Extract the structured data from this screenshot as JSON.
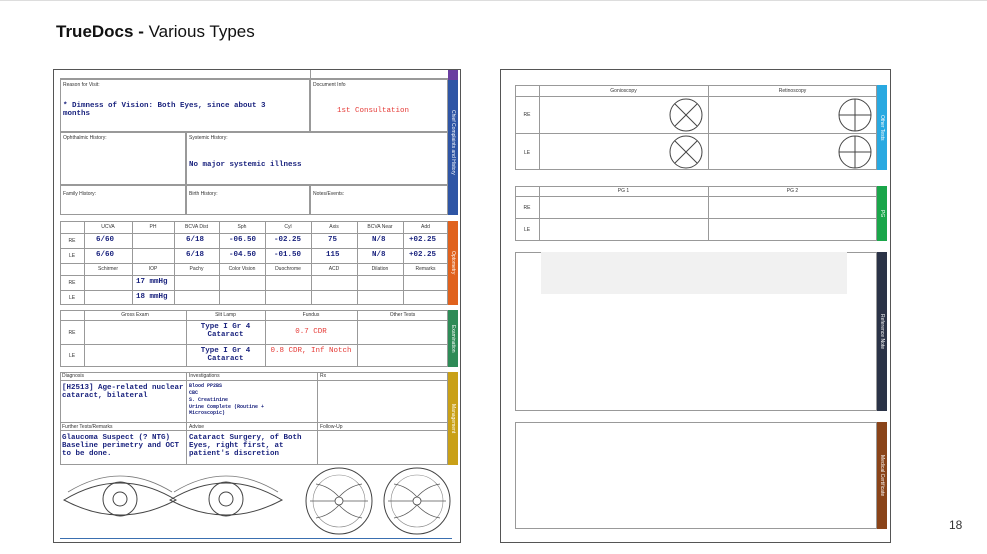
{
  "slide": {
    "title_bold": "TrueDocs -",
    "title_rest": " Various Types",
    "page_number": "18"
  },
  "left_doc": {
    "reason_label": "Reason for Visit:",
    "document_info_label": "Document Info",
    "reason_text": "* Dimness of Vision: Both Eyes, since about 3 months",
    "document_info_value": "1st Consultation",
    "ophthalmic_history_label": "Ophthalmic History:",
    "systemic_history_label": "Systemic History:",
    "systemic_history_value": "No major systemic illness",
    "family_history_label": "Family History:",
    "birth_history_label": "Birth History:",
    "notes_label": "Notes/Events:",
    "tab_chief": "Chief Complaints and History",
    "tab_optometry": "Optometry",
    "tab_examination": "Examination",
    "tab_management": "Management",
    "opto_headers": [
      "UCVA",
      "PH",
      "BCVA Dist",
      "Sph",
      "Cyl",
      "Axis",
      "BCVA Near",
      "Add"
    ],
    "opto_rows": [
      {
        "eye": "RE",
        "values": [
          "6/60",
          "",
          "6/18",
          "-06.50",
          "-02.25",
          "75",
          "N/8",
          "+02.25"
        ]
      },
      {
        "eye": "LE",
        "values": [
          "6/60",
          "",
          "6/18",
          "-04.50",
          "-01.50",
          "115",
          "N/8",
          "+02.25"
        ]
      }
    ],
    "opto2_headers": [
      "Schirmer",
      "IOP",
      "Pachy",
      "Color Vision",
      "Duochrome",
      "ACD",
      "Dilation",
      "Remarks"
    ],
    "opto2_rows": [
      {
        "eye": "RE",
        "iop": "17 mmHg"
      },
      {
        "eye": "LE",
        "iop": "18 mmHg"
      }
    ],
    "exam_headers": [
      "Gross Exam",
      "Slit Lamp",
      "Fundus",
      "Other Tests"
    ],
    "exam_rows": [
      {
        "eye": "RE",
        "slit": "Type I Gr 4 Cataract",
        "fundus": "0.7 CDR"
      },
      {
        "eye": "LE",
        "slit": "Type I Gr 4 Cataract",
        "fundus": "0.8 CDR, Inf Notch"
      }
    ],
    "diagnosis_label": "Diagnosis",
    "investigations_label": "Investigations",
    "rx_label": "Rx",
    "diagnosis_value": "[H2513] Age-related nuclear cataract, bilateral",
    "investigations_values": [
      "Blood PP2BS",
      "CBC",
      "S. Creatinine",
      "Urine Complete (Routine + Microscopic)"
    ],
    "further_label": "Further Tests/Remarks",
    "advise_label": "Advise",
    "followup_label": "Follow-Up",
    "further_value": "Glaucoma Suspect (? NTG) Baseline perimetry and OCT to be done.",
    "advise_value": "Cataract Surgery, of Both Eyes, right first, at patient's discretion"
  },
  "right_doc": {
    "other_headers": [
      "Gonioscopy",
      "Retinoscopy"
    ],
    "other_rows": [
      "RE",
      "LE"
    ],
    "tab_other": "Other Tests",
    "pg_headers": [
      "PG 1",
      "PG 2"
    ],
    "pg_rows": [
      "RE",
      "LE"
    ],
    "tab_pg": "PG",
    "tab_reference": "Reference Note",
    "tab_certificate": "Medical Certificate"
  },
  "colors": {
    "purple": "#6a3fa0",
    "blue": "#2e55a5",
    "orange": "#e0621e",
    "green": "#2e8b57",
    "gold": "#c9a017",
    "sky": "#29a9e1",
    "pg_green": "#1aa64a",
    "navy": "#2b3347",
    "brown": "#8a4419"
  }
}
